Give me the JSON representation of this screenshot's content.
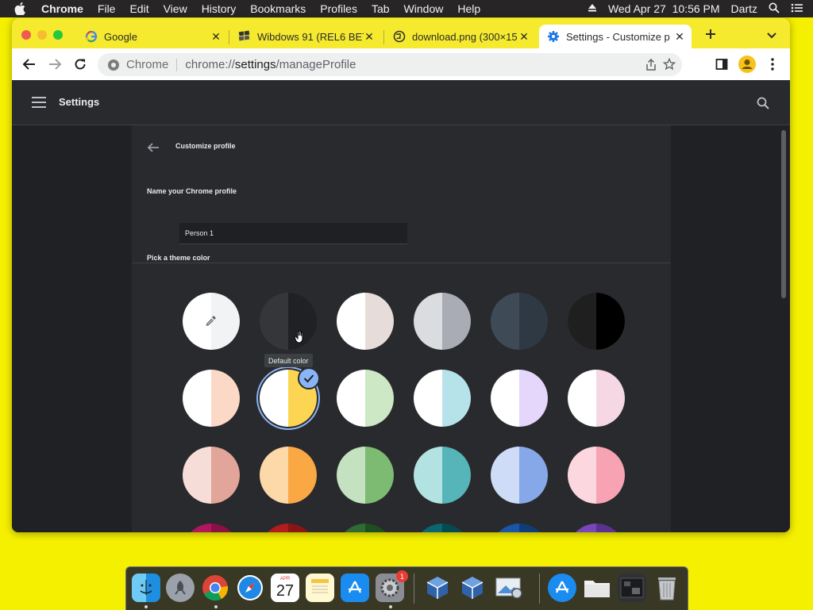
{
  "menubar": {
    "app": "Chrome",
    "items": [
      "File",
      "Edit",
      "View",
      "History",
      "Bookmarks",
      "Profiles",
      "Tab",
      "Window",
      "Help"
    ],
    "datetime": "Wed Apr 27  10:56 PM",
    "user": "Dartz"
  },
  "tabs": [
    {
      "title": "Google",
      "icon": "google-icon"
    },
    {
      "title": "Wibdows 91 (REL6 BET",
      "icon": "site-favicon"
    },
    {
      "title": "download.png (300×15",
      "icon": "globe-icon"
    },
    {
      "title": "Settings - Customize p",
      "icon": "gear-icon",
      "active": true
    }
  ],
  "omnibox": {
    "site_label": "Chrome",
    "url_prefix": "chrome://",
    "url_host": "settings",
    "url_path": "/manageProfile"
  },
  "settings": {
    "header_title": "Settings",
    "page_title": "Customize profile",
    "name_section_label": "Name your Chrome profile",
    "profile_name_value": "Person 1",
    "theme_section_label": "Pick a theme color",
    "tooltip": "Default color"
  },
  "theme_swatches": [
    {
      "name": "custom-color",
      "left": "#ffffff",
      "right": "#f1f3f4"
    },
    {
      "name": "default-color",
      "left": "#35363a",
      "right": "#202124"
    },
    {
      "name": "warm-grey",
      "left": "#ffffff",
      "right": "#e6dcd9"
    },
    {
      "name": "cool-grey",
      "left": "#dadce0",
      "right": "#a9acb4"
    },
    {
      "name": "midnight-blue",
      "left": "#3e4a56",
      "right": "#2e3943"
    },
    {
      "name": "black",
      "left": "#1f1f1f",
      "right": "#000000"
    },
    {
      "name": "beige-white",
      "left": "#ffffff",
      "right": "#fcd9c7"
    },
    {
      "name": "yellow-white",
      "left": "#ffffff",
      "right": "#fcd653",
      "selected": true
    },
    {
      "name": "green-white",
      "left": "#ffffff",
      "right": "#cde8c4"
    },
    {
      "name": "light-teal-white",
      "left": "#ffffff",
      "right": "#b6e3ea"
    },
    {
      "name": "light-purple-white",
      "left": "#ffffff",
      "right": "#e5d6fc"
    },
    {
      "name": "pink-white",
      "left": "#ffffff",
      "right": "#f6d8e4"
    },
    {
      "name": "beige",
      "left": "#f7ddd7",
      "right": "#e2a599"
    },
    {
      "name": "orange",
      "left": "#fdd8a8",
      "right": "#f9a843"
    },
    {
      "name": "light-green",
      "left": "#c4e1c0",
      "right": "#7dbb73"
    },
    {
      "name": "light-teal",
      "left": "#b2e2e1",
      "right": "#55b5b8"
    },
    {
      "name": "light-blue",
      "left": "#cfdcf8",
      "right": "#86a8e8"
    },
    {
      "name": "light-pink",
      "left": "#fdd7df",
      "right": "#f7a3b4"
    },
    {
      "name": "dark-pink",
      "left": "#b0175e",
      "right": "#8a1045"
    },
    {
      "name": "dark-red",
      "left": "#b21d1d",
      "right": "#8a1515"
    },
    {
      "name": "dark-green",
      "left": "#2f6b33",
      "right": "#1e4f23"
    },
    {
      "name": "dark-teal",
      "left": "#0b6670",
      "right": "#064950"
    },
    {
      "name": "dark-blue",
      "left": "#1a56a5",
      "right": "#103d7a"
    },
    {
      "name": "purple",
      "left": "#7846b8",
      "right": "#5a3190"
    }
  ],
  "dock_icons": [
    "finder-icon",
    "launchpad-icon",
    "chrome-icon",
    "safari-icon",
    "calendar-icon",
    "notes-icon",
    "app-store-icon",
    "system-preferences-icon",
    "virtualbox-icon",
    "virtualbox-icon",
    "preview-icon",
    "app-store-icon",
    "folder-icon",
    "screenshot-icon",
    "trash-icon"
  ],
  "dock": {
    "calendar_month": "APR",
    "calendar_day": "27",
    "sysprefs_badge": "1"
  }
}
